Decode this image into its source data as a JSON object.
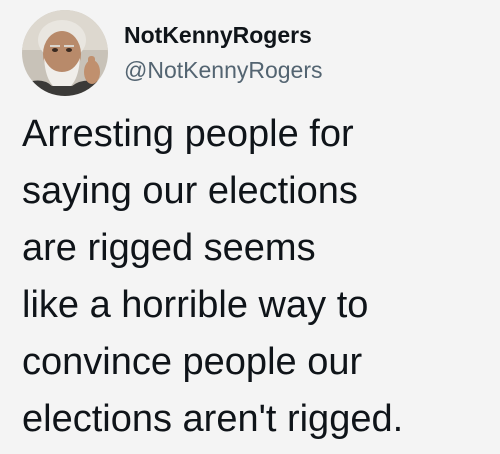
{
  "tweet": {
    "author": {
      "display_name": "NotKennyRogers",
      "handle": "@NotKennyRogers",
      "avatar_icon": "profile-photo"
    },
    "text_lines": [
      "Arresting people for",
      "saying our elections",
      "are rigged seems",
      "like a horrible way to",
      "convince people our",
      "elections aren't rigged."
    ]
  },
  "colors": {
    "background": "#f4f4f4",
    "text_primary": "#0f1419",
    "text_secondary": "#536471"
  }
}
